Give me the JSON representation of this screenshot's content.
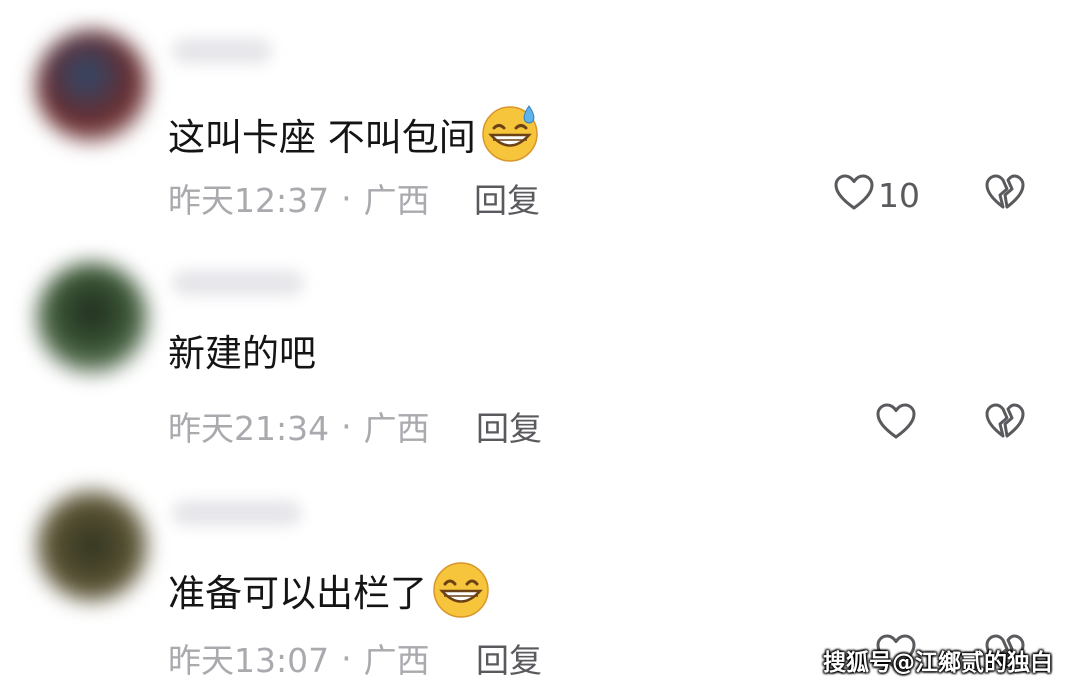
{
  "comments": [
    {
      "text": "这叫卡座 不叫包间",
      "emoji": "grinning-sweat-emoji",
      "time": "昨天12:37",
      "separator": "·",
      "location": "广西",
      "reply_label": "回复",
      "like_count": "10"
    },
    {
      "text": "新建的吧",
      "emoji": "",
      "time": "昨天21:34",
      "separator": "·",
      "location": "广西",
      "reply_label": "回复",
      "like_count": ""
    },
    {
      "text": "准备可以出栏了",
      "emoji": "beaming-grin-emoji",
      "time": "昨天13:07",
      "separator": "·",
      "location": "广西",
      "reply_label": "回复",
      "like_count": ""
    }
  ],
  "watermark": "搜狐号@江鄉贰的独白",
  "colors": {
    "text": "#141414",
    "meta": "#a9a9ae",
    "action": "#5a5a5e",
    "background": "#ffffff"
  },
  "icons": {
    "like": "heart-outline-icon",
    "dislike": "broken-heart-icon"
  }
}
